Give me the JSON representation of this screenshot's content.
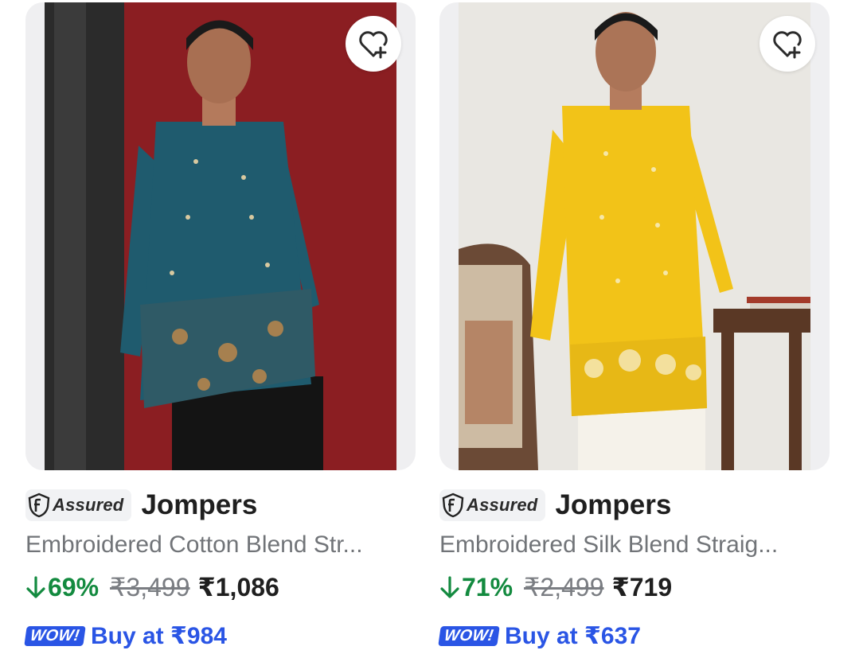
{
  "products": [
    {
      "assured_label": "Assured",
      "brand": "Jompers",
      "title": "Embroidered Cotton Blend Str...",
      "discount": "69%",
      "mrp": "₹3,499",
      "price": "₹1,086",
      "wow_label": "WOW!",
      "offer": "Buy at ₹984",
      "kurta_color": "#1f5b6e",
      "bg_color": "#8b1e22"
    },
    {
      "assured_label": "Assured",
      "brand": "Jompers",
      "title": "Embroidered Silk Blend Straig...",
      "discount": "71%",
      "mrp": "₹2,499",
      "price": "₹719",
      "wow_label": "WOW!",
      "offer": "Buy at ₹637",
      "kurta_color": "#f2c318",
      "bg_color": "#e9e7e2"
    }
  ],
  "icons": {
    "wishlist": "heart-plus-icon",
    "assured": "flipkart-assured-shield-icon",
    "discount": "down-arrow-icon"
  }
}
